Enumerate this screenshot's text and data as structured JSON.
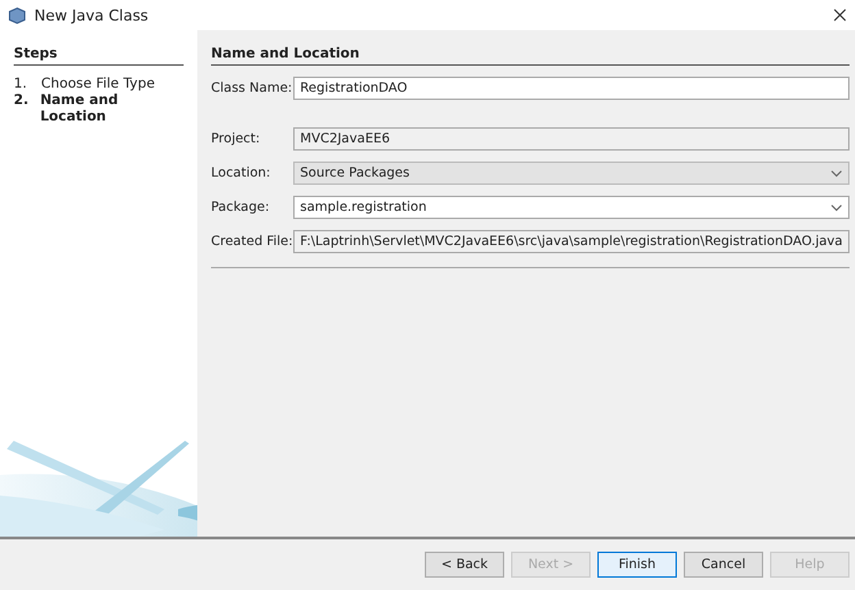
{
  "window": {
    "title": "New Java Class"
  },
  "steps": {
    "heading": "Steps",
    "items": [
      {
        "number": "1.",
        "label": "Choose File Type",
        "selected": false
      },
      {
        "number": "2.",
        "label": "Name and Location",
        "selected": true
      }
    ]
  },
  "panel": {
    "heading": "Name and Location",
    "fields": [
      {
        "label": "Class Name:",
        "value": "RegistrationDAO",
        "kind": "text"
      },
      {
        "label": "Project:",
        "value": "MVC2JavaEE6",
        "kind": "readonly"
      },
      {
        "label": "Location:",
        "value": "Source Packages",
        "kind": "combo"
      },
      {
        "label": "Package:",
        "value": "sample.registration",
        "kind": "editable-combo"
      },
      {
        "label": "Created File:",
        "value": "F:\\Laptrinh\\Servlet\\MVC2JavaEE6\\src\\java\\sample\\registration\\RegistrationDAO.java",
        "kind": "readonly"
      }
    ]
  },
  "buttons": [
    {
      "label": "< Back",
      "disabled": false,
      "focused": false
    },
    {
      "label": "Next >",
      "disabled": true,
      "focused": false
    },
    {
      "label": "Finish",
      "disabled": false,
      "focused": true
    },
    {
      "label": "Cancel",
      "disabled": false,
      "focused": false
    },
    {
      "label": "Help",
      "disabled": true,
      "focused": false
    }
  ]
}
